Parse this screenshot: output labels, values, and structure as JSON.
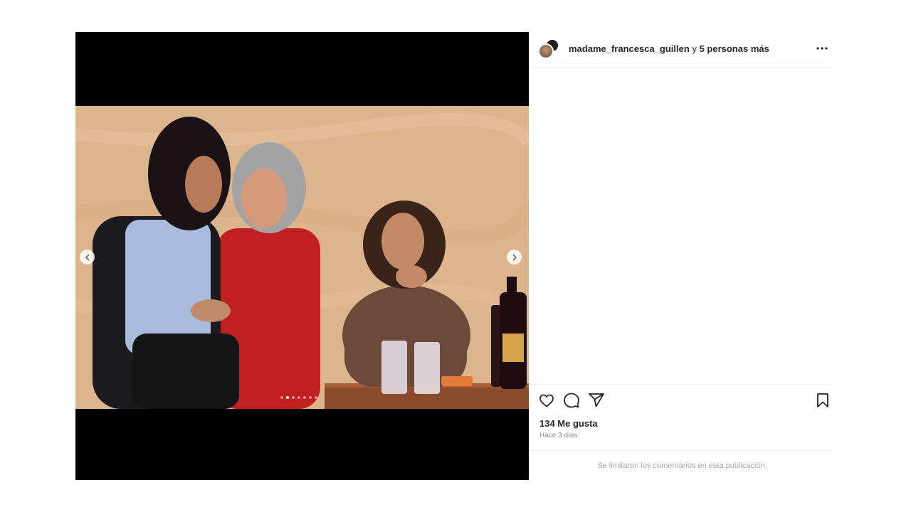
{
  "post": {
    "header": {
      "username": "madame_francesca_guillen",
      "connector": "y",
      "others": "5 personas más"
    },
    "media": {
      "carousel_total": 7,
      "carousel_active_index": 1
    },
    "likes": "134 Me gusta",
    "time": "Hace 3 días",
    "comments_notice": "Se limitaron los comentarios en esta publicación."
  },
  "icons": {
    "more": "more-options-icon",
    "like": "heart-icon",
    "comment": "comment-icon",
    "share": "share-icon",
    "save": "bookmark-icon",
    "prev": "chevron-left-icon",
    "next": "chevron-right-icon"
  },
  "colors": {
    "text": "#262626",
    "muted": "#8e8e8e",
    "divider": "#efefef"
  }
}
